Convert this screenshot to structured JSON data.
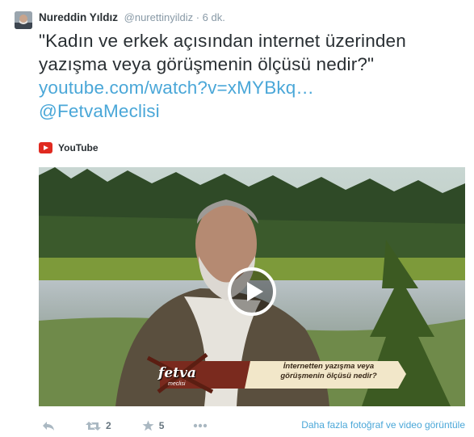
{
  "tweet": {
    "author": {
      "name": "Nureddin Yıldız",
      "handle": "@nurettinyildiz",
      "time": "· 6 dk."
    },
    "text_lines": [
      "\"Kadın ve erkek açısından internet üzerinden",
      "yazışma veya görüşmenin ölçüsü nedir?\""
    ],
    "link": "youtube.com/watch?v=xMYBkq…",
    "mention": "@FetvaMeclisi"
  },
  "card": {
    "source_icon": "youtube-icon",
    "source_label": "YouTube",
    "video": {
      "play_icon": "play-icon",
      "caption_line1": "İnternetten yazışma veya",
      "caption_line2": "görüşmenin ölçüsü nedir?",
      "brand": "fetva",
      "brand_sub": "meclisi"
    }
  },
  "actions": {
    "reply_icon": "reply-icon",
    "retweet_icon": "retweet-icon",
    "retweet_count": "2",
    "favorite_icon": "star-icon",
    "favorite_count": "5",
    "more_icon": "more-icon",
    "more_media_label": "Daha fazla fotoğraf ve video görüntüle"
  },
  "colors": {
    "link": "#4aa7d8",
    "muted": "#8899a6",
    "youtube": "#e02a20"
  }
}
